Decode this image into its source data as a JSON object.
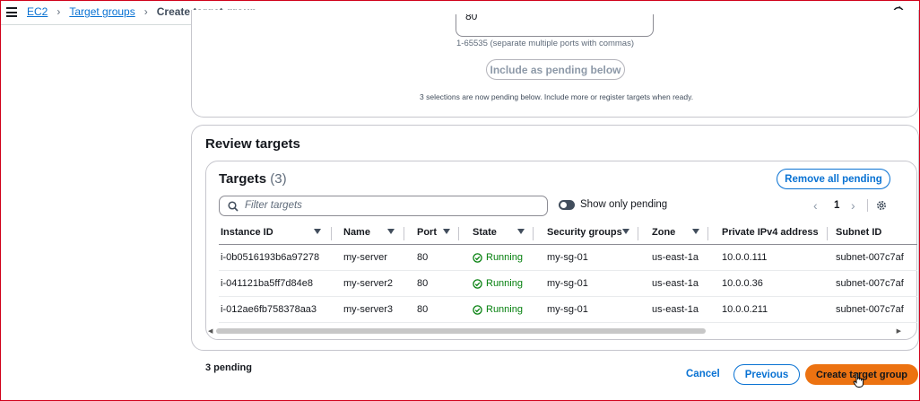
{
  "breadcrumb": {
    "items": [
      "EC2",
      "Target groups"
    ],
    "current": "Create target group"
  },
  "ports": {
    "value": "80",
    "hint": "1-65535 (separate multiple ports with commas)",
    "include_button": "Include as pending below",
    "pending_note": "3 selections are now pending below. Include more or register targets when ready."
  },
  "review": {
    "title": "Review targets",
    "targets_title": "Targets",
    "targets_count": "(3)",
    "remove_all_label": "Remove all pending",
    "filter_placeholder": "Filter targets",
    "show_only_pending_label": "Show only pending",
    "page_number": "1",
    "columns": [
      "Instance ID",
      "Name",
      "Port",
      "State",
      "Security groups",
      "Zone",
      "Private IPv4 address",
      "Subnet ID"
    ],
    "rows": [
      {
        "instance_id": "i-0b0516193b6a97278",
        "name": "my-server",
        "port": "80",
        "state": "Running",
        "security_groups": "my-sg-01",
        "zone": "us-east-1a",
        "ipv4": "10.0.0.111",
        "subnet": "subnet-007c7af"
      },
      {
        "instance_id": "i-041121ba5ff7d84e8",
        "name": "my-server2",
        "port": "80",
        "state": "Running",
        "security_groups": "my-sg-01",
        "zone": "us-east-1a",
        "ipv4": "10.0.0.36",
        "subnet": "subnet-007c7af"
      },
      {
        "instance_id": "i-012ae6fb758378aa3",
        "name": "my-server3",
        "port": "80",
        "state": "Running",
        "security_groups": "my-sg-01",
        "zone": "us-east-1a",
        "ipv4": "10.0.0.211",
        "subnet": "subnet-007c7af"
      }
    ]
  },
  "footer": {
    "pending_count": "3 pending",
    "cancel_label": "Cancel",
    "previous_label": "Previous",
    "create_label": "Create target group"
  },
  "colors": {
    "link": "#0972d3",
    "primary_button": "#ec7211",
    "running": "#037f0c"
  }
}
